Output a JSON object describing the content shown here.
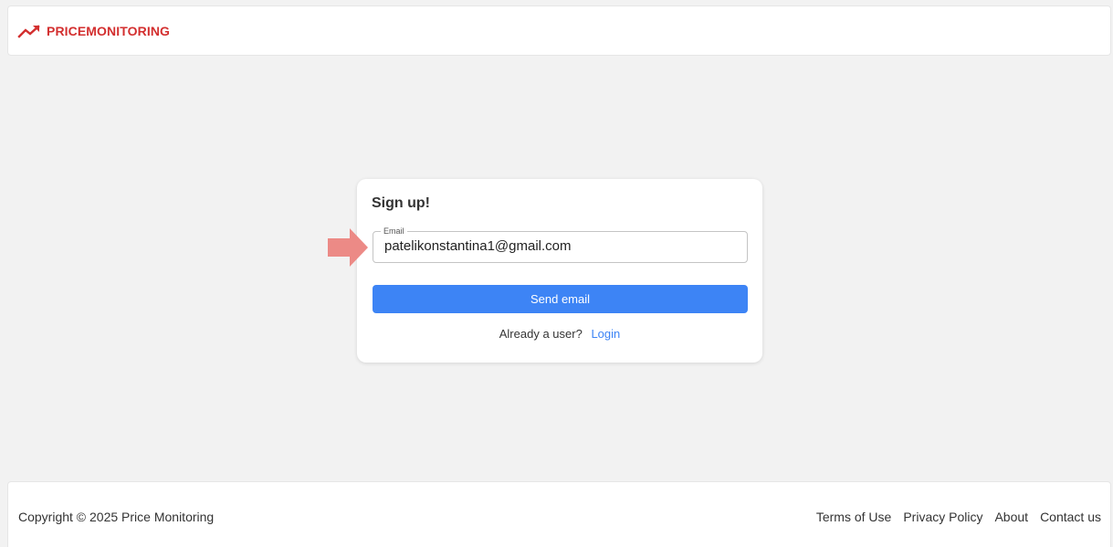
{
  "header": {
    "brand_name": "PRICEMONITORING",
    "brand_color": "#d32f2f",
    "brand_icon": "trending-up-icon"
  },
  "signup": {
    "title": "Sign up!",
    "email_label": "Email",
    "email_value": "patelikonstantina1@gmail.com",
    "send_button_label": "Send email",
    "already_user_text": "Already a user?",
    "login_link_label": "Login",
    "accent_color": "#3d84f5"
  },
  "annotation": {
    "arrow_icon": "arrow-right-icon",
    "arrow_color": "#ec8a86"
  },
  "footer": {
    "copyright": "Copyright © 2025 Price Monitoring",
    "links": [
      {
        "label": "Terms of Use"
      },
      {
        "label": "Privacy Policy"
      },
      {
        "label": "About"
      },
      {
        "label": "Contact us"
      }
    ]
  }
}
